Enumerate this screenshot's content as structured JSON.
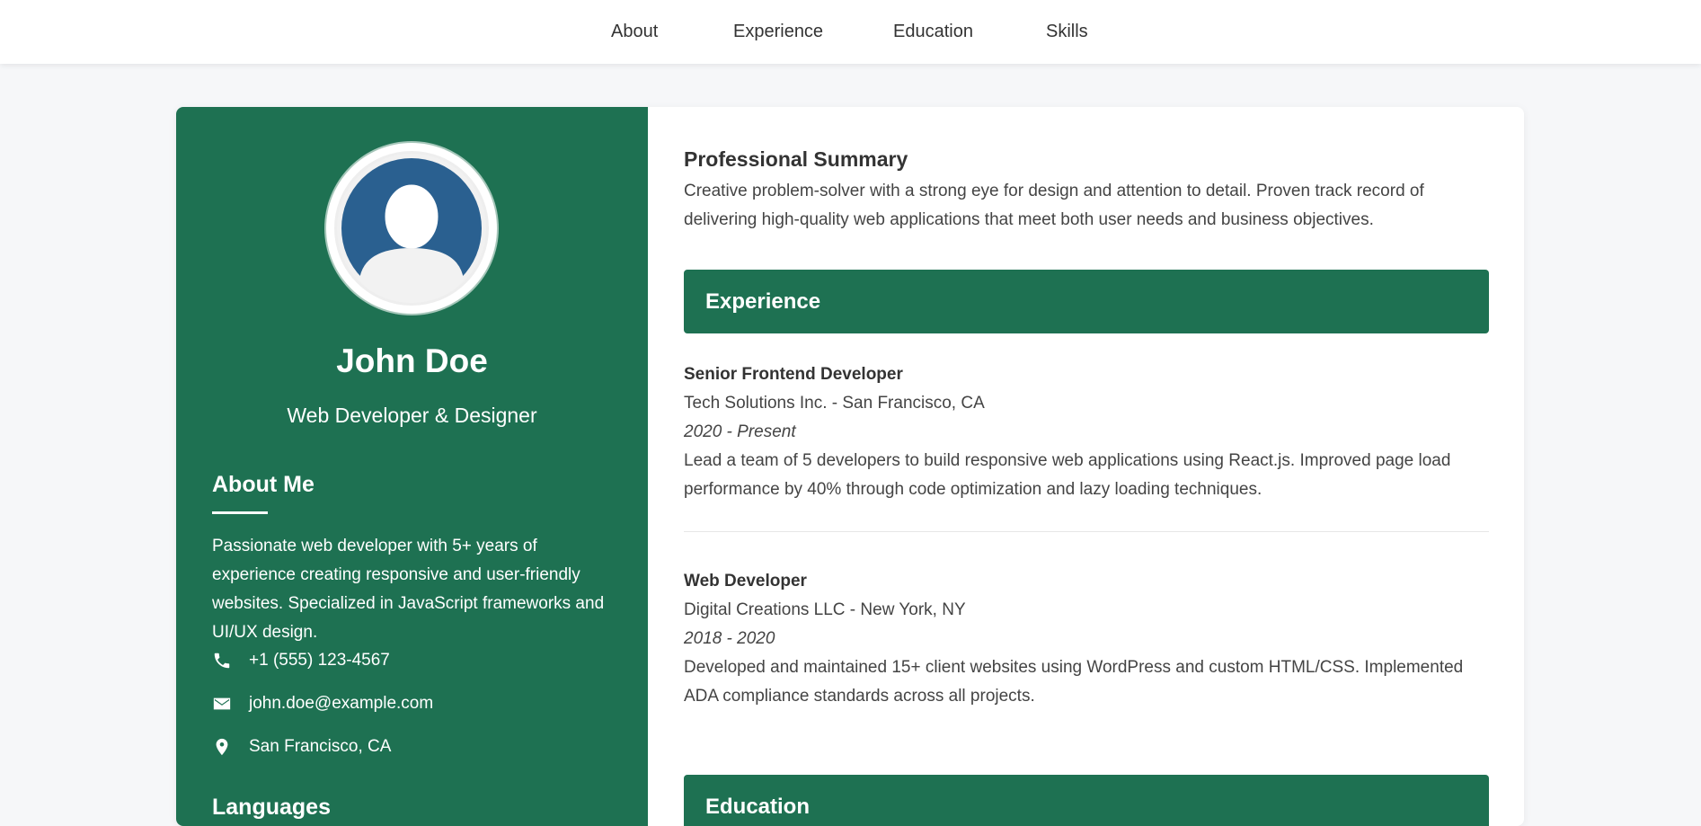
{
  "nav": {
    "items": [
      "About",
      "Experience",
      "Education",
      "Skills"
    ]
  },
  "profile": {
    "name": "John Doe",
    "role": "Web Developer & Designer",
    "avatar_icon": "user-avatar-icon"
  },
  "about": {
    "heading": "About Me",
    "text": "Passionate web developer with 5+ years of experience creating responsive and user-friendly websites. Specialized in JavaScript frameworks and UI/UX design."
  },
  "contacts": [
    {
      "icon": "phone-icon",
      "text": "+1 (555) 123-4567"
    },
    {
      "icon": "email-icon",
      "text": "john.doe@example.com"
    },
    {
      "icon": "location-icon",
      "text": "San Francisco, CA"
    }
  ],
  "languages": {
    "heading": "Languages"
  },
  "summary": {
    "heading": "Professional Summary",
    "text": "Creative problem-solver with a strong eye for design and attention to detail. Proven track record of delivering high-quality web applications that meet both user needs and business objectives."
  },
  "experience": {
    "heading": "Experience",
    "jobs": [
      {
        "title": "Senior Frontend Developer",
        "company": "Tech Solutions Inc. - San Francisco, CA",
        "dates": "2020 - Present",
        "description": "Lead a team of 5 developers to build responsive web applications using React.js. Improved page load performance by 40% through code optimization and lazy loading techniques."
      },
      {
        "title": "Web Developer",
        "company": "Digital Creations LLC - New York, NY",
        "dates": "2018 - 2020",
        "description": "Developed and maintained 15+ client websites using WordPress and custom HTML/CSS. Implemented ADA compliance standards across all projects."
      }
    ]
  },
  "education": {
    "heading": "Education"
  },
  "colors": {
    "brand_green": "#1e7152",
    "avatar_blue": "#2a6090",
    "page_bg": "#f6f7f9"
  }
}
